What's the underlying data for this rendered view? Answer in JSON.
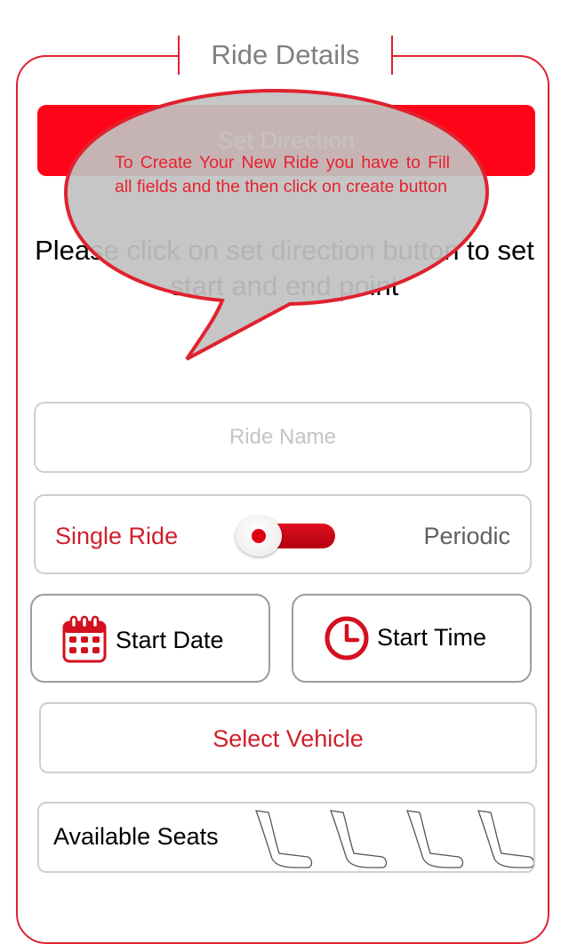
{
  "header": {
    "title": "Ride Details"
  },
  "actions": {
    "set_direction_label": "Set Direction"
  },
  "instruction": "Please click on set direction button to set start and end point",
  "tooltip": {
    "text": "To Create Your New Ride you have to Fill all fields and the then click on create button"
  },
  "form": {
    "ride_name_placeholder": "Ride Name",
    "ride_type": {
      "left_label": "Single Ride",
      "right_label": "Periodic",
      "selected": "Single Ride"
    },
    "start_date_label": "Start Date",
    "start_time_label": "Start Time",
    "select_vehicle_label": "Select Vehicle",
    "available_seats_label": "Available Seats",
    "seats": [
      "seat-icon",
      "seat-icon",
      "seat-icon",
      "seat-icon"
    ]
  },
  "colors": {
    "accent": "#e0222e",
    "button_red": "#ff0418",
    "tooltip_fill": "#c2c2c2"
  },
  "icons": {
    "date": "calendar-icon",
    "time": "clock-icon",
    "seat": "seat-icon"
  }
}
